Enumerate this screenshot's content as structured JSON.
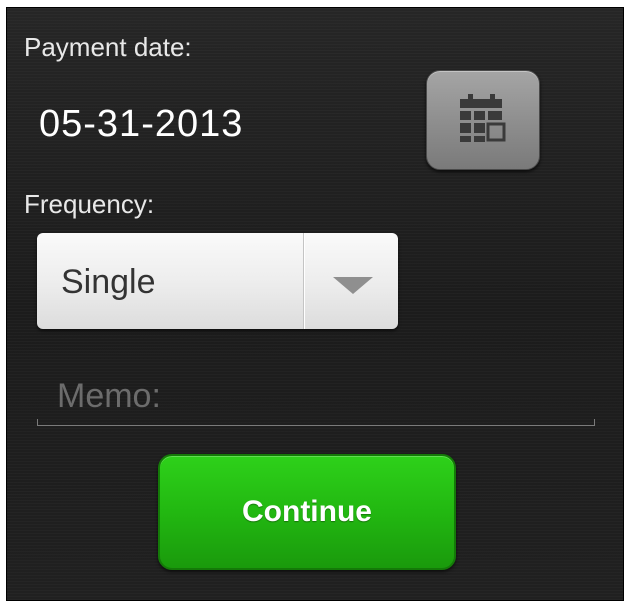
{
  "payment": {
    "label": "Payment date:",
    "date_value": "05-31-2013",
    "calendar_button_icon": "calendar-icon"
  },
  "frequency": {
    "label": "Frequency:",
    "selected": "Single",
    "dropdown_icon": "triangle-down-icon"
  },
  "memo": {
    "placeholder": "Memo:",
    "value": ""
  },
  "actions": {
    "continue_label": "Continue",
    "continue_color": "#22b811"
  }
}
